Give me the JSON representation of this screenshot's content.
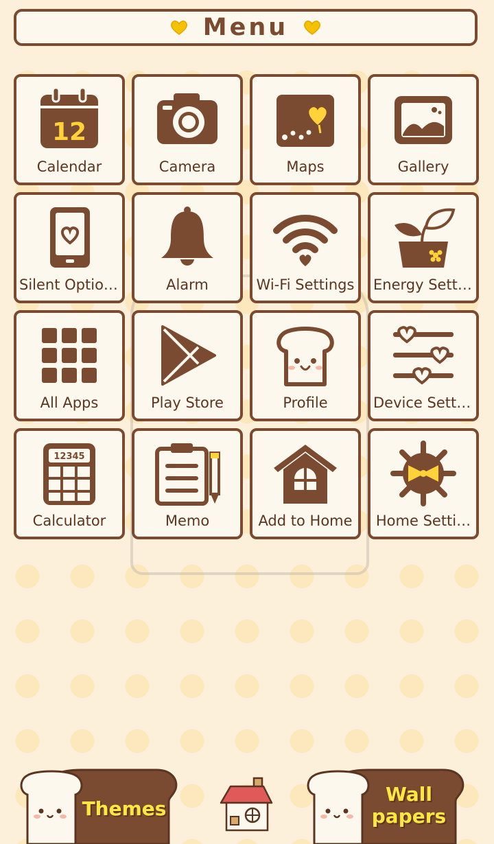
{
  "header": {
    "title": "Menu"
  },
  "colors": {
    "brown": "#7a4a31",
    "cream": "#fdf8ee",
    "yellow": "#ffd23a",
    "background": "#fdf0da"
  },
  "tiles": [
    {
      "label": "Calendar",
      "icon": "calendar-icon",
      "icon_text": "12"
    },
    {
      "label": "Camera",
      "icon": "camera-icon"
    },
    {
      "label": "Maps",
      "icon": "map-icon"
    },
    {
      "label": "Gallery",
      "icon": "gallery-icon"
    },
    {
      "label": "Silent Options",
      "icon": "phone-heart-icon"
    },
    {
      "label": "Alarm",
      "icon": "bell-icon"
    },
    {
      "label": "Wi-Fi Settings",
      "icon": "wifi-icon"
    },
    {
      "label": "Energy Setti…",
      "icon": "plant-icon"
    },
    {
      "label": "All Apps",
      "icon": "apps-grid-icon"
    },
    {
      "label": "Play Store",
      "icon": "play-store-icon"
    },
    {
      "label": "Profile",
      "icon": "toast-face-icon"
    },
    {
      "label": "Device Setti…",
      "icon": "sliders-icon"
    },
    {
      "label": "Calculator",
      "icon": "calculator-icon",
      "icon_text": "12345"
    },
    {
      "label": "Memo",
      "icon": "clipboard-icon"
    },
    {
      "label": "Add to Home",
      "icon": "house-icon"
    },
    {
      "label": "Home Setti…",
      "icon": "gear-bow-icon"
    }
  ],
  "bottom": {
    "themes_label": "Themes",
    "wallpapers_line1": "Wall",
    "wallpapers_line2": "papers"
  }
}
